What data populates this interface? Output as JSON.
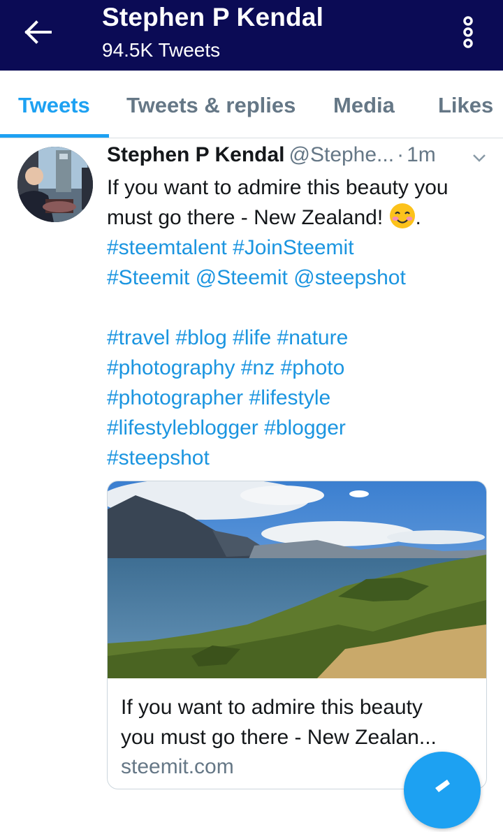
{
  "header": {
    "back_icon": "arrow-left-icon",
    "title": "Stephen P Kendal",
    "subtitle": "94.5K Tweets",
    "overflow_icon": "more-vertical-icon",
    "background_color": "#0b0b55"
  },
  "tabs": [
    {
      "label": "Tweets",
      "active": true
    },
    {
      "label": "Tweets & replies",
      "active": false
    },
    {
      "label": "Media",
      "active": false
    },
    {
      "label": "Likes",
      "active": false
    }
  ],
  "tweet": {
    "author_name": "Stephen P Kendal",
    "author_handle": "@Stephe...",
    "separator": "·",
    "time": "1m",
    "caret_icon": "chevron-down-icon",
    "text_line_1": "If you want to admire this beauty you",
    "text_line_2": "must go there - New Zealand! ",
    "text_line_2_emoji": "smiling-face-icon",
    "text_line_2_end": ".",
    "hashtags_line_1": [
      "#steemtalent",
      "#JoinSteemit"
    ],
    "hashtags_line_2": [
      "#Steemit",
      "@Steemit",
      "@steepshot"
    ],
    "hashtags_line_3": [
      "#travel",
      "#blog",
      "#life",
      "#nature"
    ],
    "hashtags_line_4": [
      "#photography",
      "#nz",
      "#photo"
    ],
    "hashtags_line_5": [
      "#photographer",
      "#lifestyle"
    ],
    "hashtags_line_6": [
      "#lifestyleblogger",
      "#blogger"
    ],
    "hashtags_line_7": [
      "#steepshot"
    ]
  },
  "card": {
    "title_line_1": "If you want to admire this beauty",
    "title_line_2": "you must go there - New Zealan...",
    "domain": "steemit.com"
  },
  "fab": {
    "icon": "compose-icon"
  },
  "colors": {
    "accent": "#1da1f2",
    "link": "#1b95e0",
    "muted": "#657786"
  }
}
